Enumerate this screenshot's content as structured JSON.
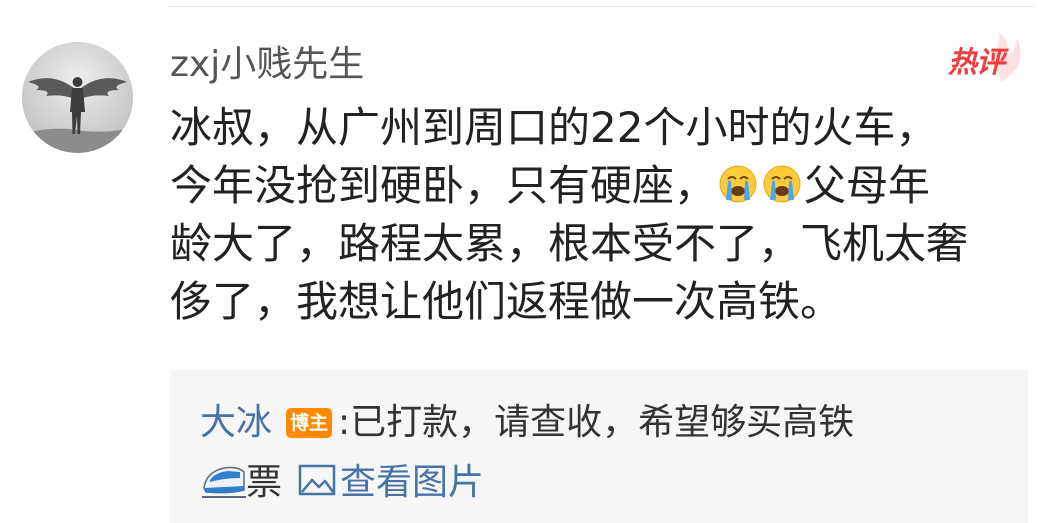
{
  "comment": {
    "username": "zxj小贱先生",
    "hot_badge": "热评",
    "text_line1": "冰叔，从广州到周口的22个小时的火车，",
    "text_line2_before_emoji": "今年没抢到硬卧，只有硬座，",
    "text_line2_after_emoji": "父母年",
    "text_line3": "龄大了，路程太累，根本受不了，飞机太奢",
    "text_line4": "侈了，我想让他们返程做一次高铁。",
    "emoji_icon": "loudly-crying-face-icon"
  },
  "reply": {
    "author": "大冰",
    "author_badge": "博主",
    "text_line1": ":已打款，请查收，希望够买高铁",
    "text_line2": "票",
    "train_icon": "high-speed-train-icon",
    "view_image_label": "查看图片",
    "image_icon": "image-icon"
  },
  "colors": {
    "link_blue": "#4873a5",
    "hot_red": "#ee3d3d",
    "badge_orange": "#ff8a00",
    "reply_bg": "#f6f6f6"
  }
}
